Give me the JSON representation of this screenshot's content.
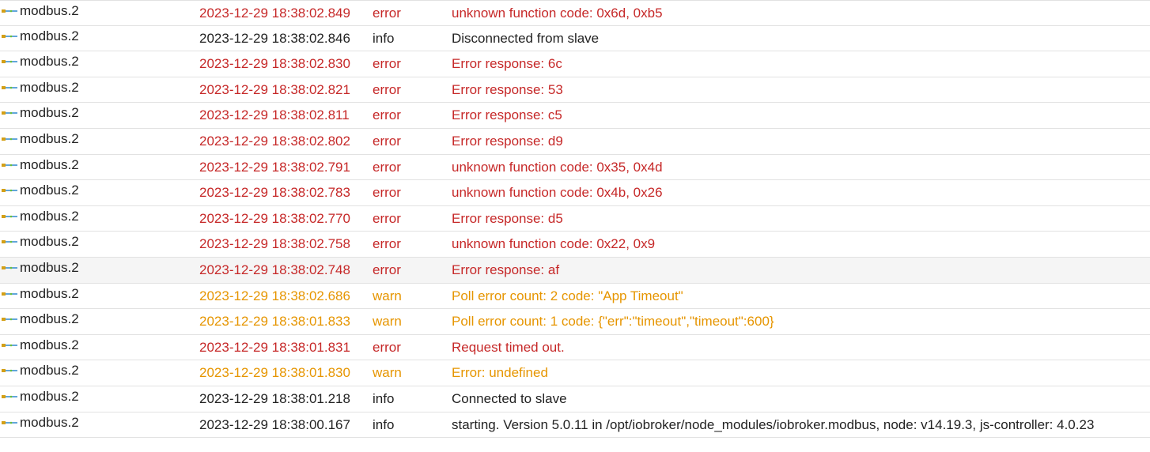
{
  "colors": {
    "error": "#c62828",
    "warn": "#e69500",
    "info": "#222222"
  },
  "icon": "adapter-icon",
  "rows": [
    {
      "source": "modbus.2",
      "time": "2023-12-29 18:38:02.849",
      "severity": "error",
      "message": "unknown function code: 0x6d, 0xb5"
    },
    {
      "source": "modbus.2",
      "time": "2023-12-29 18:38:02.846",
      "severity": "info",
      "message": "Disconnected from slave"
    },
    {
      "source": "modbus.2",
      "time": "2023-12-29 18:38:02.830",
      "severity": "error",
      "message": "Error response: 6c"
    },
    {
      "source": "modbus.2",
      "time": "2023-12-29 18:38:02.821",
      "severity": "error",
      "message": "Error response: 53"
    },
    {
      "source": "modbus.2",
      "time": "2023-12-29 18:38:02.811",
      "severity": "error",
      "message": "Error response: c5"
    },
    {
      "source": "modbus.2",
      "time": "2023-12-29 18:38:02.802",
      "severity": "error",
      "message": "Error response: d9"
    },
    {
      "source": "modbus.2",
      "time": "2023-12-29 18:38:02.791",
      "severity": "error",
      "message": "unknown function code: 0x35, 0x4d"
    },
    {
      "source": "modbus.2",
      "time": "2023-12-29 18:38:02.783",
      "severity": "error",
      "message": "unknown function code: 0x4b, 0x26"
    },
    {
      "source": "modbus.2",
      "time": "2023-12-29 18:38:02.770",
      "severity": "error",
      "message": "Error response: d5"
    },
    {
      "source": "modbus.2",
      "time": "2023-12-29 18:38:02.758",
      "severity": "error",
      "message": "unknown function code: 0x22, 0x9"
    },
    {
      "source": "modbus.2",
      "time": "2023-12-29 18:38:02.748",
      "severity": "error",
      "message": "Error response: af",
      "highlight": true
    },
    {
      "source": "modbus.2",
      "time": "2023-12-29 18:38:02.686",
      "severity": "warn",
      "message": "Poll error count: 2 code: \"App Timeout\""
    },
    {
      "source": "modbus.2",
      "time": "2023-12-29 18:38:01.833",
      "severity": "warn",
      "message": "Poll error count: 1 code: {\"err\":\"timeout\",\"timeout\":600}"
    },
    {
      "source": "modbus.2",
      "time": "2023-12-29 18:38:01.831",
      "severity": "error",
      "message": "Request timed out."
    },
    {
      "source": "modbus.2",
      "time": "2023-12-29 18:38:01.830",
      "severity": "warn",
      "message": "Error: undefined"
    },
    {
      "source": "modbus.2",
      "time": "2023-12-29 18:38:01.218",
      "severity": "info",
      "message": "Connected to slave"
    },
    {
      "source": "modbus.2",
      "time": "2023-12-29 18:38:00.167",
      "severity": "info",
      "message": "starting. Version 5.0.11 in /opt/iobroker/node_modules/iobroker.modbus, node: v14.19.3, js-controller: 4.0.23"
    }
  ]
}
